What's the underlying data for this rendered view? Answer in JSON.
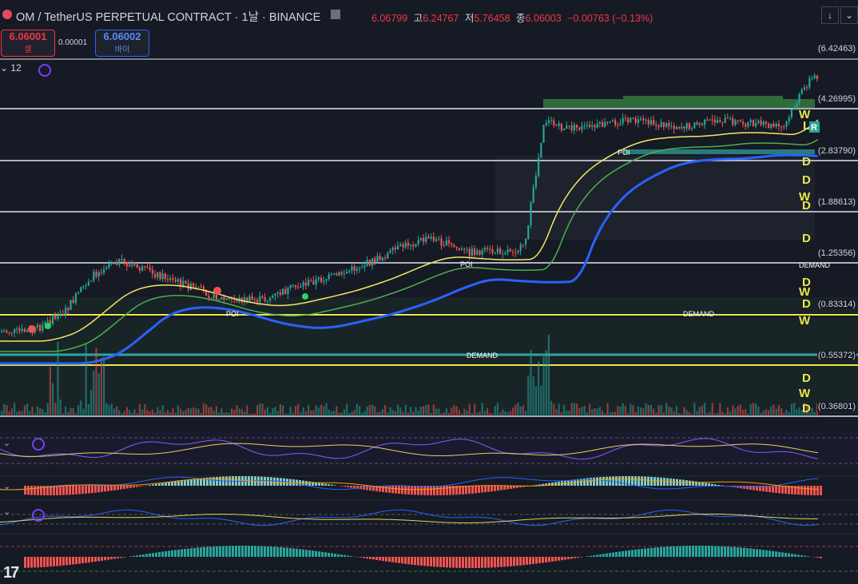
{
  "header": {
    "title": "OM / TetherUS PERPETUAL CONTRACT · 1날 · BINANCE",
    "ohlc_open_value": "6.06799",
    "ohlc_high_label": "고",
    "ohlc_high_value": "6.24767",
    "ohlc_low_label": "저",
    "ohlc_low_value": "5.76458",
    "ohlc_close_label": "종",
    "ohlc_close_value": "6.06003",
    "ohlc_change": "−0.00763 (−0.13%)"
  },
  "trade": {
    "sell_price": "6.06001",
    "sell_label": "셀",
    "spread": "0.00001",
    "buy_price": "6.06002",
    "buy_label": "바이"
  },
  "indicators": {
    "toggle_label": "12"
  },
  "price_axis": {
    "labels": [
      "(6.42463)",
      "(4.26995)",
      "(2.83790)",
      "(1.88613)",
      "(1.25356)",
      "(0.83314)",
      "(0.55372)",
      "(0.36801)"
    ]
  },
  "annotations": {
    "poi": "POI",
    "demand": "DEMAND",
    "d": "D",
    "w": "W",
    "l": "L",
    "r": "R"
  },
  "logo": "17",
  "colors": {
    "bg": "#161a25",
    "up": "#26a69a",
    "down": "#ef5350",
    "ema_fast": "#f5e663",
    "ema_mid": "#4caf50",
    "ema_slow": "#2962ff",
    "level": "#e0e3eb",
    "level_yellow": "#e8e84a",
    "level_teal": "#2aa6a0"
  }
}
